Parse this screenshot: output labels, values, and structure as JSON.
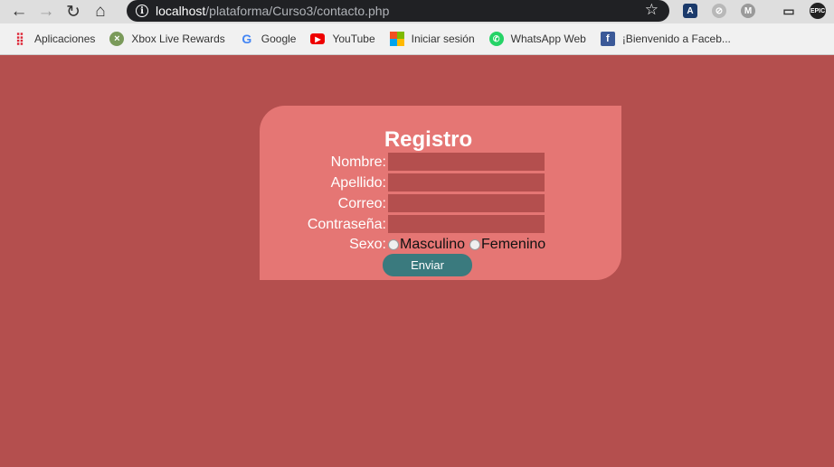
{
  "browser": {
    "url_host": "localhost",
    "url_path": "/plataforma/Curso3/contacto.php",
    "bookmarks": [
      {
        "label": "Aplicaciones",
        "icon": "apps-grid-icon"
      },
      {
        "label": "Xbox Live Rewards",
        "icon": "xbox-icon"
      },
      {
        "label": "Google",
        "icon": "google-icon"
      },
      {
        "label": "YouTube",
        "icon": "youtube-icon"
      },
      {
        "label": "Iniciar sesión",
        "icon": "microsoft-icon"
      },
      {
        "label": "WhatsApp Web",
        "icon": "whatsapp-icon"
      },
      {
        "label": "¡Bienvenido a Faceb...",
        "icon": "facebook-icon"
      }
    ]
  },
  "form": {
    "title": "Registro",
    "labels": {
      "nombre": "Nombre:",
      "apellido": "Apellido:",
      "correo": "Correo:",
      "password": "Contraseña:",
      "sexo": "Sexo:"
    },
    "values": {
      "nombre": "",
      "apellido": "",
      "correo": "",
      "password": ""
    },
    "options": {
      "male": "Masculino",
      "female": "Femenino"
    },
    "submit": "Enviar"
  },
  "colors": {
    "page_background": "#b44f4e",
    "card_background": "#e57674",
    "button": "#3a7a7e"
  }
}
